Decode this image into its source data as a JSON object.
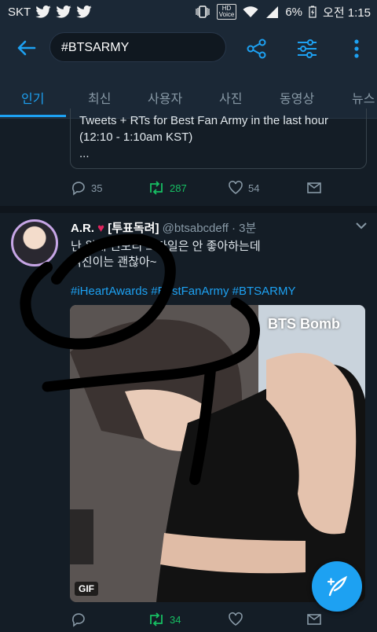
{
  "status_bar": {
    "carrier": "SKT",
    "hd_label": "HD\nVoice",
    "battery": "6%",
    "time": "오전 1:15"
  },
  "app_bar": {
    "search_value": "#BTSARMY",
    "icons": [
      "back-arrow-icon",
      "share-icon",
      "filter-sliders-icon",
      "more-vertical-icon"
    ]
  },
  "tabs": [
    {
      "label": "인기",
      "active": true
    },
    {
      "label": "최신",
      "active": false
    },
    {
      "label": "사용자",
      "active": false
    },
    {
      "label": "사진",
      "active": false
    },
    {
      "label": "동영상",
      "active": false
    },
    {
      "label": "뉴스",
      "active": false
    }
  ],
  "tweet1": {
    "card_lines": [
      "Tweets + RTs for Best Fan Army in the last hour",
      "(12:10 - 1:10am KST)",
      "..."
    ],
    "reply_count": "35",
    "retweet_count": "287",
    "like_count": "54"
  },
  "tweet2": {
    "name": "A.R.",
    "name_tag": "[투표독려]",
    "handle": "@btsabcdeff",
    "time": "· 3분",
    "text_line1": "난 원래 민모리 스타일은 안 좋아하는데",
    "text_line2": "석진이는 괜찮아~",
    "hashtags": "#iHeartAwards #BestFanArmy #BTSARMY",
    "media_watermark": "BTS Bomb",
    "gif_label": "GIF",
    "retweet_count": "34"
  },
  "colors": {
    "accent": "#1da1f2",
    "retweet": "#17bf63",
    "background": "#141d26",
    "bar": "#1b2836"
  }
}
